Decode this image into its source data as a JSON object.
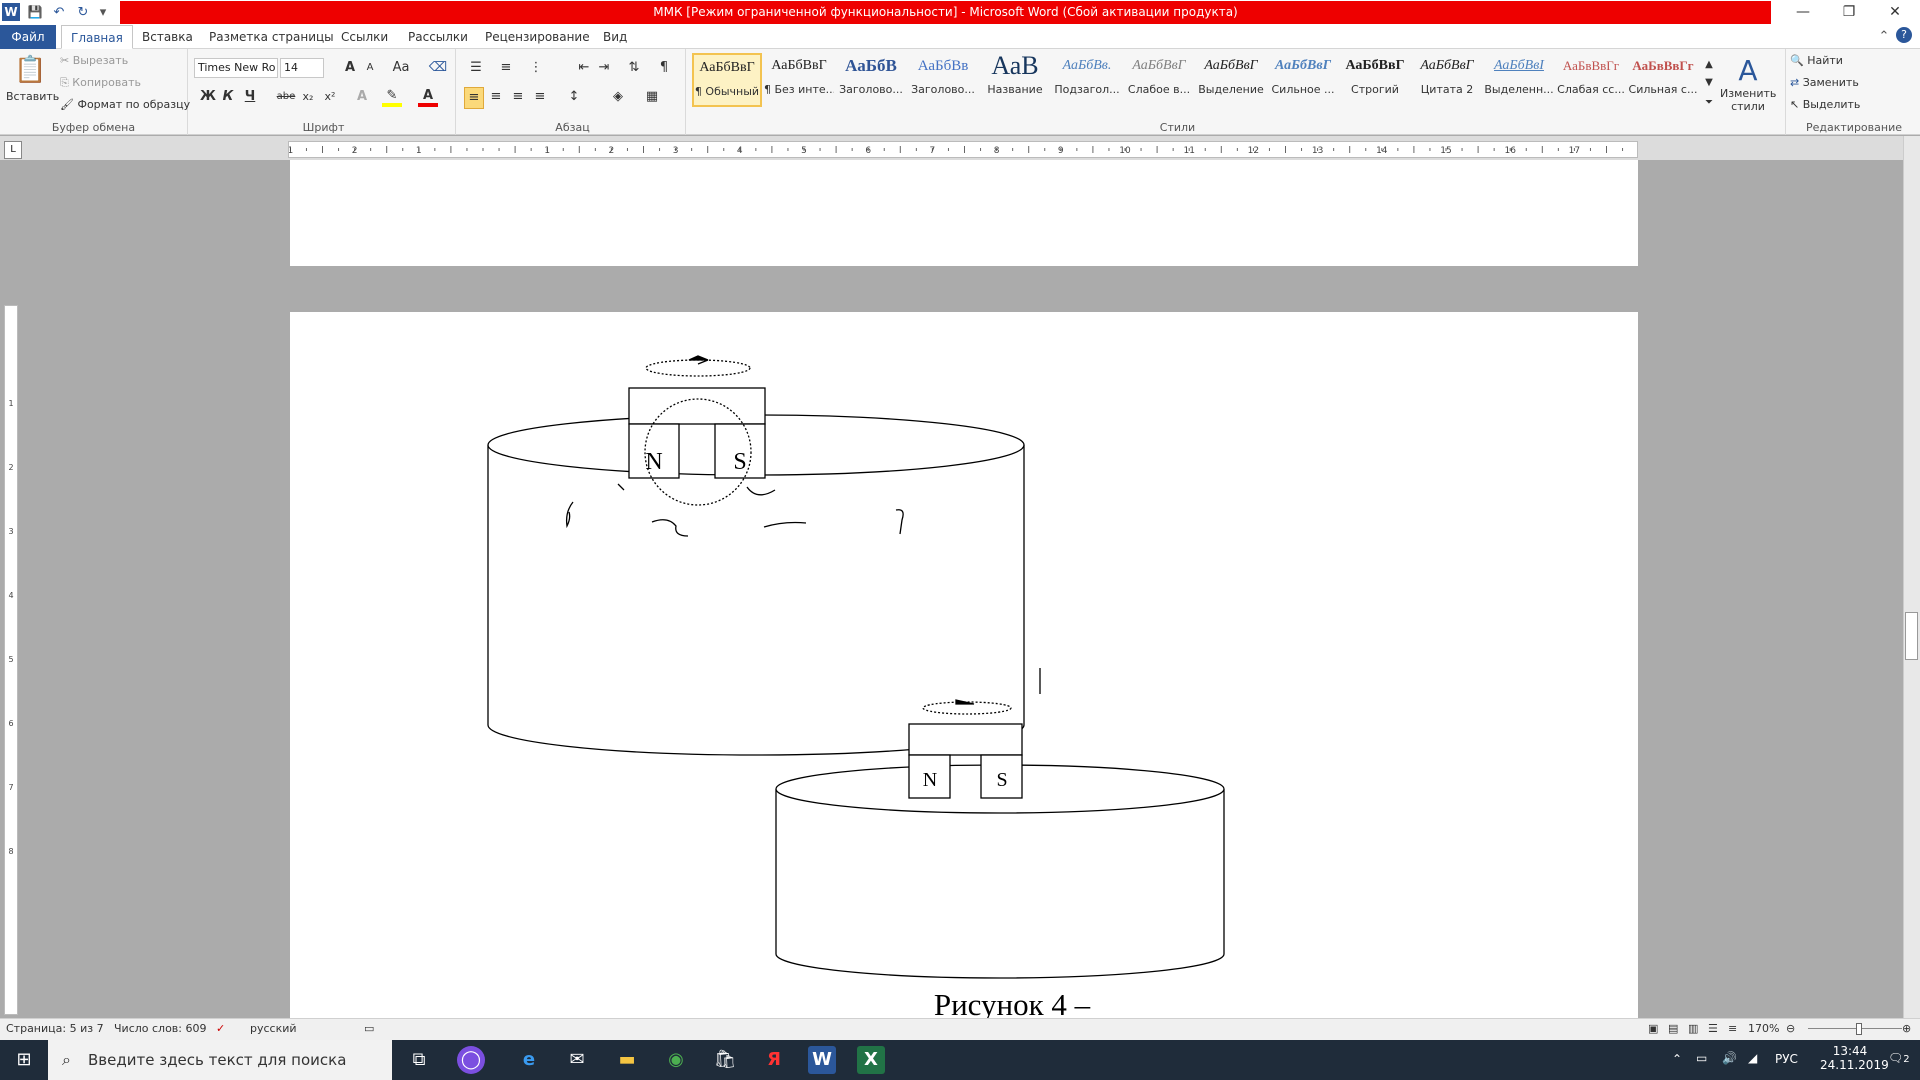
{
  "window": {
    "title": "ММК [Режим ограниченной функциональности] - Microsoft Word (Сбой активации продукта)",
    "controls": {
      "minimize": "—",
      "restore": "❐",
      "close": "✕"
    }
  },
  "qat": {
    "word_logo": "W",
    "save": "💾",
    "undo": "↶",
    "redo": "↻",
    "more": "▾"
  },
  "tabs": {
    "file": "Файл",
    "items": [
      "Главная",
      "Вставка",
      "Разметка страницы",
      "Ссылки",
      "Рассылки",
      "Рецензирование",
      "Вид"
    ],
    "active_index": 0
  },
  "ribbon": {
    "clipboard": {
      "paste": "Вставить",
      "cut": "Вырезать",
      "copy": "Копировать",
      "format_painter": "Формат по образцу",
      "label": "Буфер обмена"
    },
    "font": {
      "name": "Times New Ro",
      "size": "14",
      "grow": "A",
      "shrink": "A",
      "case": "Aa",
      "bold": "Ж",
      "italic": "К",
      "underline": "Ч",
      "strike": "abe",
      "subscript": "x₂",
      "superscript": "x²",
      "label": "Шрифт"
    },
    "paragraph": {
      "pilcrow": "¶",
      "label": "Абзац"
    },
    "styles": {
      "items": [
        {
          "sample": "АаБбВвГ",
          "name": "¶ Обычный"
        },
        {
          "sample": "АаБбВвГ",
          "name": "¶ Без инте..."
        },
        {
          "sample": "АаБбВ",
          "name": "Заголово..."
        },
        {
          "sample": "АаБбВв",
          "name": "Заголово..."
        },
        {
          "sample": "АаВ",
          "name": "Название"
        },
        {
          "sample": "АаБбВв.",
          "name": "Подзагол..."
        },
        {
          "sample": "АаБбВвГ",
          "name": "Слабое в..."
        },
        {
          "sample": "АаБбВвГ",
          "name": "Выделение"
        },
        {
          "sample": "АаБбВвГ",
          "name": "Сильное ..."
        },
        {
          "sample": "АаБбВвГ",
          "name": "Строгий"
        },
        {
          "sample": "АаБбВвГ",
          "name": "Цитата 2"
        },
        {
          "sample": "АаБбВвI",
          "name": "Выделенн..."
        },
        {
          "sample": "АаБвВвГг",
          "name": "Слабая сс..."
        },
        {
          "sample": "АаБвВвГг",
          "name": "Сильная с..."
        }
      ],
      "change_styles": "Изменить стили",
      "label": "Стили"
    },
    "editing": {
      "find": "Найти",
      "replace": "Заменить",
      "select": "Выделить",
      "label": "Редактирование"
    }
  },
  "ruler": {
    "labels": [
      "1",
      "2",
      "1",
      "1",
      "2",
      "3",
      "4",
      "5",
      "6",
      "7",
      "8",
      "9",
      "10",
      "11",
      "12",
      "13",
      "14",
      "15",
      "16",
      "17"
    ],
    "vlabels": [
      "1",
      "2",
      "3",
      "4",
      "5",
      "6",
      "7",
      "8"
    ]
  },
  "document": {
    "figure": {
      "n_label": "N",
      "s_label": "S"
    },
    "caption": "Рисунок 4 –"
  },
  "status": {
    "page": "Страница: 5 из 7",
    "words": "Число слов: 609",
    "language": "русский",
    "zoom": "170%"
  },
  "taskbar": {
    "search_placeholder": "Введите здесь текст для поиска",
    "lang": "РУС",
    "time": "13:44",
    "date": "24.11.2019",
    "notifications": "2"
  }
}
